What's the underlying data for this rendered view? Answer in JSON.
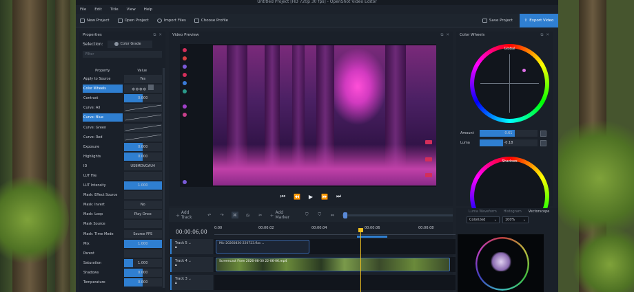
{
  "window": {
    "title": "Untitled Project [HD 720p 30 fps] - OpenShot Video Editor"
  },
  "menu": [
    "File",
    "Edit",
    "Title",
    "View",
    "Help"
  ],
  "toolbar": {
    "new_project": "New Project",
    "open_project": "Open Project",
    "import_files": "Import Files",
    "choose_profile": "Choose Profile",
    "save_project": "Save Project",
    "export_video": "Export Video"
  },
  "properties": {
    "title": "Properties",
    "selection_label": "Selection:",
    "selection_value": "Color Grade",
    "filter_placeholder": "Filter",
    "col_property": "Property",
    "col_value": "Value",
    "rows": [
      {
        "name": "Apply to Source",
        "value": "Yes",
        "kind": "text"
      },
      {
        "name": "Color Wheels",
        "value": "",
        "kind": "wheels",
        "selected": true
      },
      {
        "name": "Contrast",
        "value": "0.000",
        "kind": "slider",
        "fill": 0.5
      },
      {
        "name": "Curve: All",
        "value": "",
        "kind": "curve"
      },
      {
        "name": "Curve: Blue",
        "value": "",
        "kind": "curve",
        "selected": true
      },
      {
        "name": "Curve: Green",
        "value": "",
        "kind": "curve"
      },
      {
        "name": "Curve: Red",
        "value": "",
        "kind": "curve"
      },
      {
        "name": "Exposure",
        "value": "0.000",
        "kind": "slider",
        "fill": 0.5
      },
      {
        "name": "Highlights",
        "value": "0.000",
        "kind": "slider",
        "fill": 0.5
      },
      {
        "name": "ID",
        "value": "US9MDVGAU4",
        "kind": "plain"
      },
      {
        "name": "LUT File",
        "value": "",
        "kind": "plain"
      },
      {
        "name": "LUT Intensity",
        "value": "1.000",
        "kind": "slider",
        "fill": 1.0
      },
      {
        "name": "Mask: Effect Source",
        "value": "",
        "kind": "plain"
      },
      {
        "name": "Mask: Invert",
        "value": "No",
        "kind": "text"
      },
      {
        "name": "Mask: Loop",
        "value": "Play Once",
        "kind": "text"
      },
      {
        "name": "Mask Source",
        "value": "",
        "kind": "plain"
      },
      {
        "name": "Mask: Time Mode",
        "value": "Source FPS",
        "kind": "text"
      },
      {
        "name": "Mix",
        "value": "1.000",
        "kind": "slider",
        "fill": 1.0
      },
      {
        "name": "Parent",
        "value": "",
        "kind": "plain"
      },
      {
        "name": "Saturation",
        "value": "1.000",
        "kind": "slider",
        "fill": 0.25
      },
      {
        "name": "Shadows",
        "value": "0.000",
        "kind": "slider",
        "fill": 0.5
      },
      {
        "name": "Temperature",
        "value": "0.000",
        "kind": "slider",
        "fill": 0.5
      }
    ]
  },
  "preview": {
    "title": "Video Preview"
  },
  "color_wheels": {
    "title": "Color Wheels",
    "global_label": "Global",
    "amount_label": "Amount",
    "amount_value": "0.61",
    "amount_fill": 0.61,
    "luma_label": "Luma",
    "luma_value": "-0.18",
    "luma_fill": 0.41,
    "shadows_label": "Shadows"
  },
  "scopes": {
    "tabs": [
      "Luma Waveform",
      "Histogram",
      "Vectorscope"
    ],
    "active_tab": "Vectorscope",
    "mode": "Colorized",
    "zoom": "100%"
  },
  "timeline": {
    "timecode": "00:00:06,00",
    "add_track": "Add Track",
    "add_marker": "Add Marker",
    "ticks": [
      "0:00",
      "00:00:02",
      "00:00:04",
      "00:00:06",
      "00:00:08"
    ],
    "tracks": [
      {
        "name": "Track 5",
        "clip": "Mic-20260830-220723.flac"
      },
      {
        "name": "Track 4",
        "clip": "Screencast From 2026-08-30 22-06-06.mp4"
      },
      {
        "name": "Track 3",
        "clip": ""
      }
    ]
  }
}
